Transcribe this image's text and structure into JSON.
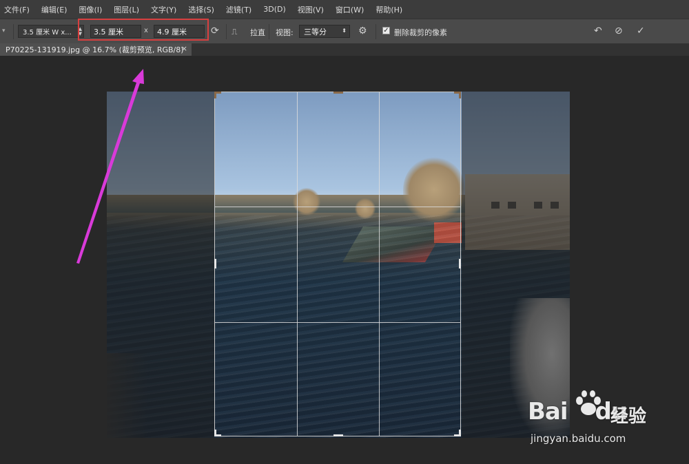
{
  "menu": [
    "文件(F)",
    "编辑(E)",
    "图像(I)",
    "图层(L)",
    "文字(Y)",
    "选择(S)",
    "滤镜(T)",
    "3D(D)",
    "视图(V)",
    "窗口(W)",
    "帮助(H)"
  ],
  "options": {
    "preset_label": "3.5 厘米  W x...",
    "width_value": "3.5 厘米",
    "times": "x",
    "height_value": "4.9 厘米",
    "straighten_label": "拉直",
    "view_label": "视图:",
    "view_value": "三等分",
    "delete_cropped_label": "删除裁剪的像素",
    "delete_cropped_checked": true
  },
  "document": {
    "tab_title": "P70225-131919.jpg @ 16.7% (裁剪预览, RGB/8)",
    "close": "×"
  },
  "annotation": {
    "arrow_color": "#d93ad9",
    "highlight_color": "#d93f3f"
  },
  "watermark": {
    "logo": "Bai",
    "logo_suffix": "du",
    "cn": "经验",
    "url": "jingyan.baidu.com"
  }
}
